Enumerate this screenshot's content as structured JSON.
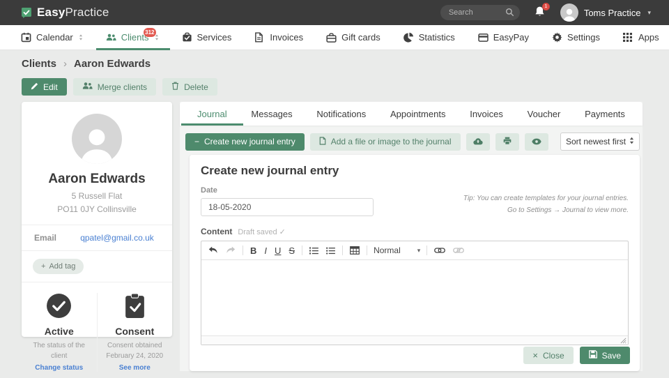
{
  "header": {
    "brand_bold": "Easy",
    "brand_light": "Practice",
    "search_placeholder": "Search",
    "notification_badge": "1",
    "profile_name": "Toms Practice"
  },
  "nav": {
    "items": [
      {
        "label": "Calendar",
        "icon": "calendar-icon",
        "has_caret": true,
        "active": false
      },
      {
        "label": "Clients",
        "icon": "clients-icon",
        "has_caret": true,
        "active": true,
        "badge": "312"
      },
      {
        "label": "Services",
        "icon": "services-icon",
        "has_caret": false,
        "active": false
      },
      {
        "label": "Invoices",
        "icon": "invoices-icon",
        "has_caret": false,
        "active": false
      },
      {
        "label": "Gift cards",
        "icon": "gift-cards-icon",
        "has_caret": false,
        "active": false
      },
      {
        "label": "Statistics",
        "icon": "statistics-icon",
        "has_caret": false,
        "active": false
      },
      {
        "label": "EasyPay",
        "icon": "easypay-icon",
        "has_caret": false,
        "active": false
      },
      {
        "label": "Settings",
        "icon": "settings-icon",
        "has_caret": false,
        "active": false
      },
      {
        "label": "Apps",
        "icon": "apps-icon",
        "has_caret": false,
        "active": false
      }
    ]
  },
  "breadcrumb": {
    "items": [
      "Clients",
      "Aaron Edwards"
    ]
  },
  "client_actions": {
    "edit": "Edit",
    "merge": "Merge clients",
    "delete": "Delete"
  },
  "client_card": {
    "name": "Aaron Edwards",
    "address_line1": "5 Russell Flat",
    "address_line2": "PO11 0JY Collinsville",
    "email_label": "Email",
    "email_value": "qpatel@gmail.co.uk",
    "add_tag_label": "Add tag",
    "status": {
      "title": "Active",
      "description": "The status of the client",
      "link": "Change status"
    },
    "consent": {
      "title": "Consent",
      "line1": "Consent obtained",
      "line2": "February 24, 2020",
      "link": "See more"
    }
  },
  "tabs": {
    "active": "Journal",
    "items": [
      {
        "label": "Journal"
      },
      {
        "label": "Messages"
      },
      {
        "label": "Notifications"
      },
      {
        "label": "Appointments"
      },
      {
        "label": "Invoices"
      },
      {
        "label": "Voucher"
      },
      {
        "label": "Payments"
      }
    ]
  },
  "journal_toolbar": {
    "create_label": "Create new journal entry",
    "add_file_label": "Add a file or image to the journal",
    "sort_value": "Sort newest first"
  },
  "form": {
    "title": "Create new journal entry",
    "date_label": "Date",
    "date_value": "18-05-2020",
    "tip_line1": "Tip: You can create templates for your journal entries.",
    "tip_line2": "Go to Settings → Journal to view more.",
    "content_label": "Content",
    "draft_status": "Draft saved",
    "close_label": "Close",
    "save_label": "Save"
  },
  "editor": {
    "bold_label": "B",
    "italic_label": "I",
    "underline_label": "U",
    "strike_label": "S",
    "paragraph_style": "Normal"
  },
  "icons": {
    "caret_down": "▾",
    "breadcrumb_separator": "›",
    "plus": "+",
    "minus": "−",
    "close": "×",
    "check": "✓"
  },
  "colors": {
    "accent_green": "#4e8a6c",
    "light_green": "#dde8e1",
    "badge_red": "#e25950",
    "link_blue": "#4a80d2",
    "header_dark": "#3b3b3b"
  }
}
